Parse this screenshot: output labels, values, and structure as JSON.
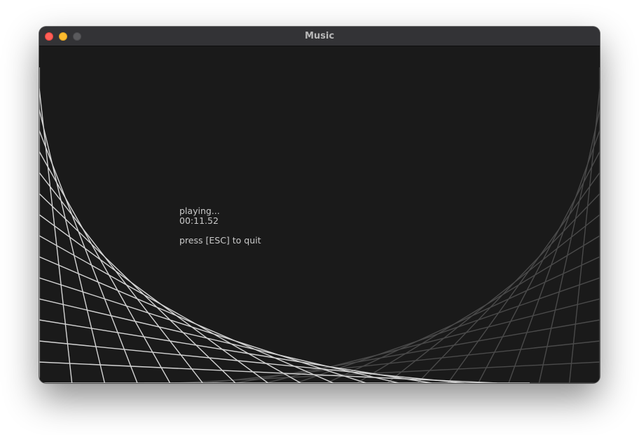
{
  "window": {
    "title": "Music"
  },
  "visualizer": {
    "status_text": "playing...",
    "elapsed_time": "00:11.52",
    "quit_hint": "press [ESC] to quit",
    "bright_line_color": "#d4d4d4",
    "dim_line_color": "#4a4a4a",
    "background_color": "#1a1a1a"
  }
}
